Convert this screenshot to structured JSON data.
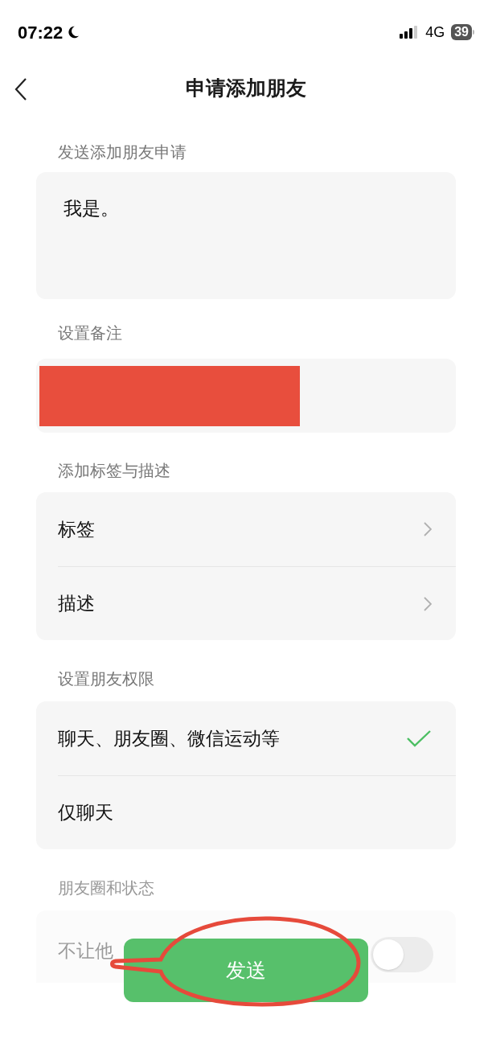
{
  "status_bar": {
    "time": "07:22",
    "network": "4G",
    "battery": "39"
  },
  "nav": {
    "title": "申请添加朋友"
  },
  "request": {
    "label": "发送添加朋友申请",
    "value": "我是。"
  },
  "remark": {
    "label": "设置备注",
    "redacted": true
  },
  "tags_section": {
    "label": "添加标签与描述",
    "rows": [
      {
        "label": "标签"
      },
      {
        "label": "描述"
      }
    ]
  },
  "permissions": {
    "label": "设置朋友权限",
    "options": [
      {
        "label": "聊天、朋友圈、微信运动等",
        "selected": true
      },
      {
        "label": "仅聊天",
        "selected": false
      }
    ]
  },
  "moments": {
    "label": "朋友圈和状态",
    "row": {
      "label": "不让他",
      "on": false
    }
  },
  "send_button": {
    "label": "发送"
  }
}
